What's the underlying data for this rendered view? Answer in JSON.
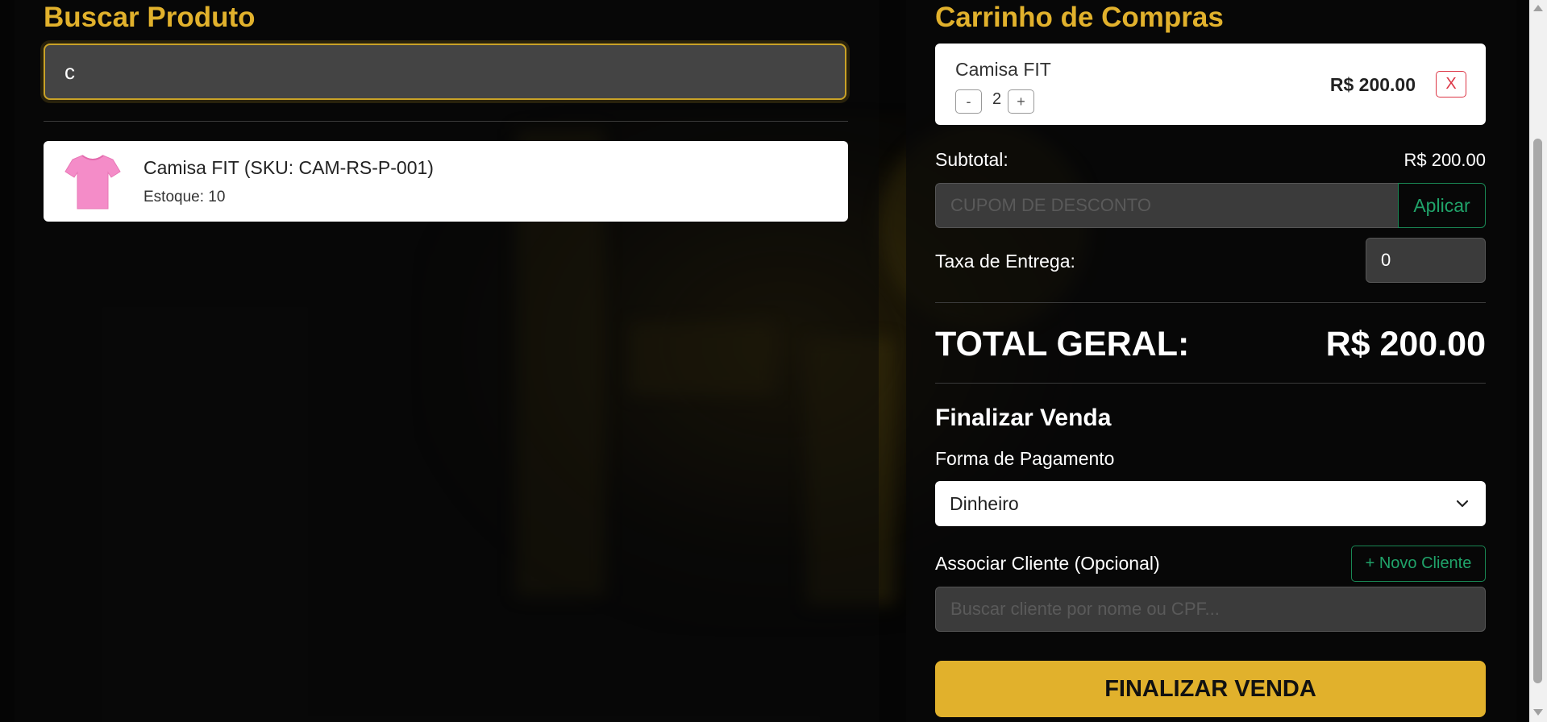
{
  "search": {
    "heading": "Buscar Produto",
    "value": "c"
  },
  "results": [
    {
      "name": "Camisa FIT (SKU: CAM-RS-P-001)",
      "stock": "Estoque: 10",
      "image_icon": "pink-tshirt-icon"
    }
  ],
  "cart": {
    "heading": "Carrinho de Compras",
    "items": [
      {
        "name": "Camisa FIT",
        "quantity": "2",
        "decrement_label": "-",
        "increment_label": "+",
        "price": "R$ 200.00",
        "remove_label": "X"
      }
    ],
    "subtotal_label": "Subtotal:",
    "subtotal_value": "R$ 200.00",
    "coupon_placeholder": "CUPOM DE DESCONTO",
    "apply_label": "Aplicar",
    "delivery_label": "Taxa de Entrega:",
    "delivery_value": "0",
    "total_label": "TOTAL GERAL:",
    "total_value": "R$ 200.00"
  },
  "checkout": {
    "title": "Finalizar Venda",
    "payment_label": "Forma de Pagamento",
    "payment_selected": "Dinheiro",
    "client_label": "Associar Cliente (Opcional)",
    "new_client_label": "+ Novo Cliente",
    "client_placeholder": "Buscar cliente por nome ou CPF...",
    "finalize_label": "FINALIZAR VENDA"
  },
  "colors": {
    "accent": "#e1b12c",
    "success": "#198754",
    "danger": "#dc3545",
    "background": "#050505"
  }
}
